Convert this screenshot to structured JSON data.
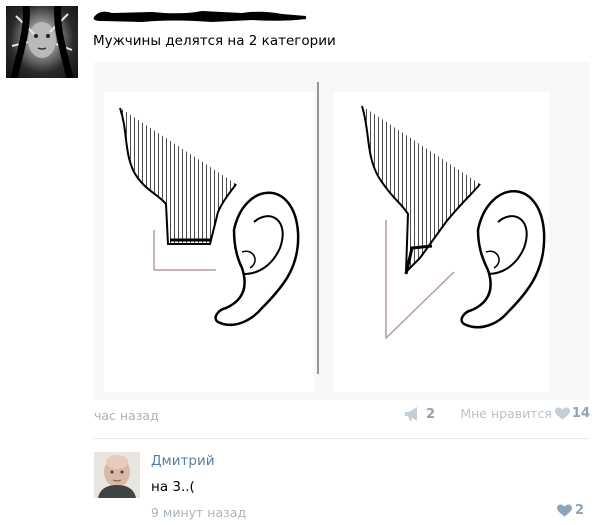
{
  "post": {
    "text": "Мужчины делятся на 2 категории",
    "time": "час назад",
    "shares": "2",
    "like_label": "Мне нравится",
    "likes": "14"
  },
  "comment": {
    "author": "Дмитрий",
    "text": "на 3..(",
    "time": "9 минут назад",
    "likes": "2"
  },
  "colors": {
    "link": "#5b7c9e",
    "meta": "#a8b3bd",
    "count": "#8fa4b8"
  },
  "icons": [
    "redacted-name",
    "megaphone-share-icon",
    "heart-icon"
  ]
}
